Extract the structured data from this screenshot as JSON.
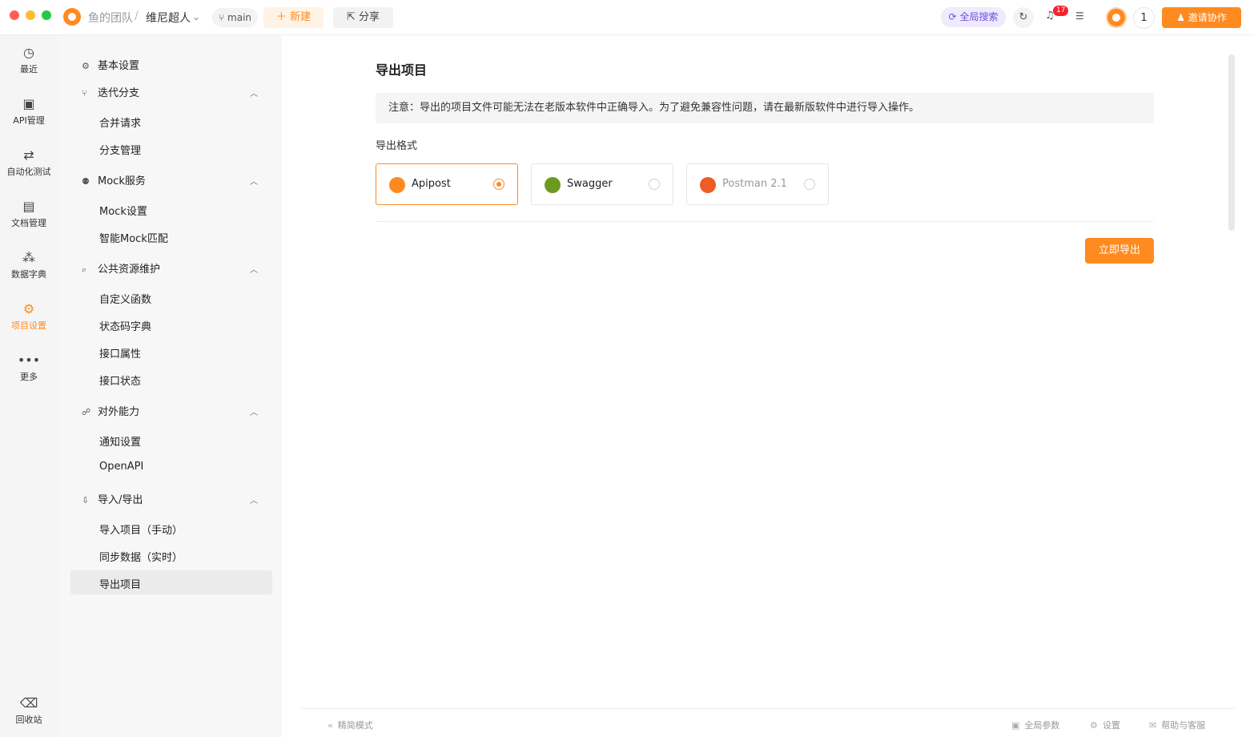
{
  "header": {
    "team": "鱼的团队",
    "separator": "/",
    "project": "维尼超人",
    "branch": "main",
    "new_label": "新建",
    "share_label": "分享",
    "global_search_label": "全局搜索",
    "notification_count": "17",
    "member_count": "1",
    "invite_label": "邀请协作"
  },
  "leftnav": [
    {
      "label": "最近",
      "icon": "history-icon"
    },
    {
      "label": "API管理",
      "icon": "api-icon"
    },
    {
      "label": "自动化测试",
      "icon": "flow-icon"
    },
    {
      "label": "文档管理",
      "icon": "document-icon"
    },
    {
      "label": "数据字典",
      "icon": "dictionary-icon"
    },
    {
      "label": "项目设置",
      "icon": "project-settings-icon",
      "active": true
    },
    {
      "label": "更多",
      "icon": "more-icon"
    },
    {
      "label": "回收站",
      "icon": "trash-icon"
    }
  ],
  "settings_nav": {
    "basic": "基本设置",
    "iteration": "迭代分支",
    "merge_request": "合并请求",
    "branch_manage": "分支管理",
    "mock": "Mock服务",
    "mock_settings": "Mock设置",
    "smart_mock": "智能Mock匹配",
    "public_resources": "公共资源维护",
    "custom_functions": "自定义函数",
    "status_codes": "状态码字典",
    "api_props": "接口属性",
    "api_status": "接口状态",
    "external": "对外能力",
    "notification": "通知设置",
    "openapi": "OpenAPI",
    "import_export": "导入/导出",
    "import_manual": "导入项目（手动）",
    "sync_realtime": "同步数据（实时）",
    "export_project": "导出项目"
  },
  "main": {
    "title": "导出项目",
    "notice": "注意：导出的项目文件可能无法在老版本软件中正确导入。为了避免兼容性问题，请在最新版软件中进行导入操作。",
    "format_label": "导出格式",
    "formats": [
      {
        "name": "Apipost",
        "selected": true,
        "color": "#ff8a1f"
      },
      {
        "name": "Swagger",
        "selected": false,
        "color": "#6a9a1f"
      },
      {
        "name": "Postman 2.1",
        "selected": false,
        "color": "#ef5b25"
      }
    ],
    "export_button": "立即导出"
  },
  "footer": {
    "compact_mode": "精简模式",
    "global_params": "全局参数",
    "settings": "设置",
    "help": "帮助与客服"
  }
}
